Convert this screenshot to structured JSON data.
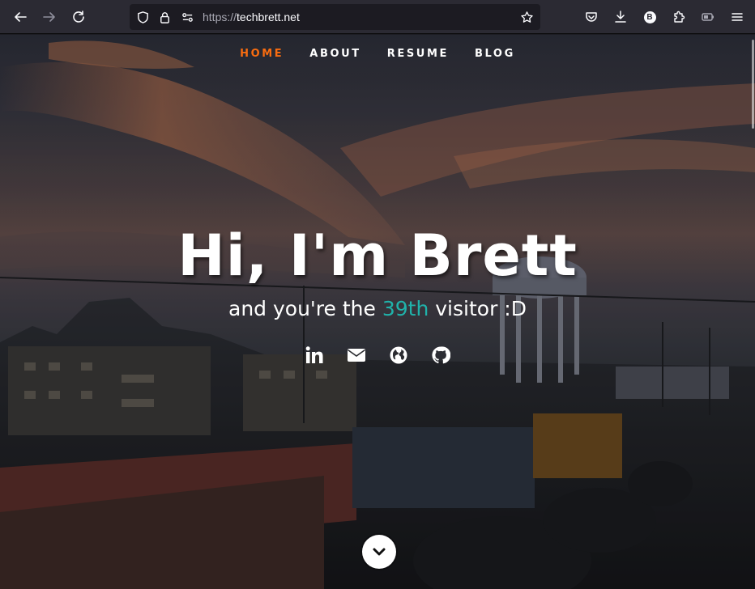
{
  "browser": {
    "url_scheme": "https://",
    "url_host": "techbrett.net",
    "profile_initial": "B"
  },
  "nav": {
    "items": [
      {
        "label": "HOME",
        "active": true
      },
      {
        "label": "ABOUT",
        "active": false
      },
      {
        "label": "RESUME",
        "active": false
      },
      {
        "label": "BLOG",
        "active": false
      }
    ]
  },
  "hero": {
    "title": "Hi, I'm Brett",
    "subtitle_before": "and you're the ",
    "visitor_count": "39th",
    "subtitle_after": " visitor :D"
  },
  "socials": [
    "linkedin-icon",
    "email-icon",
    "globe-icon",
    "github-icon"
  ],
  "colors": {
    "accent_orange": "#f86c10",
    "visitor_teal": "#20b2aa",
    "chrome_bg": "#2b2a33"
  }
}
